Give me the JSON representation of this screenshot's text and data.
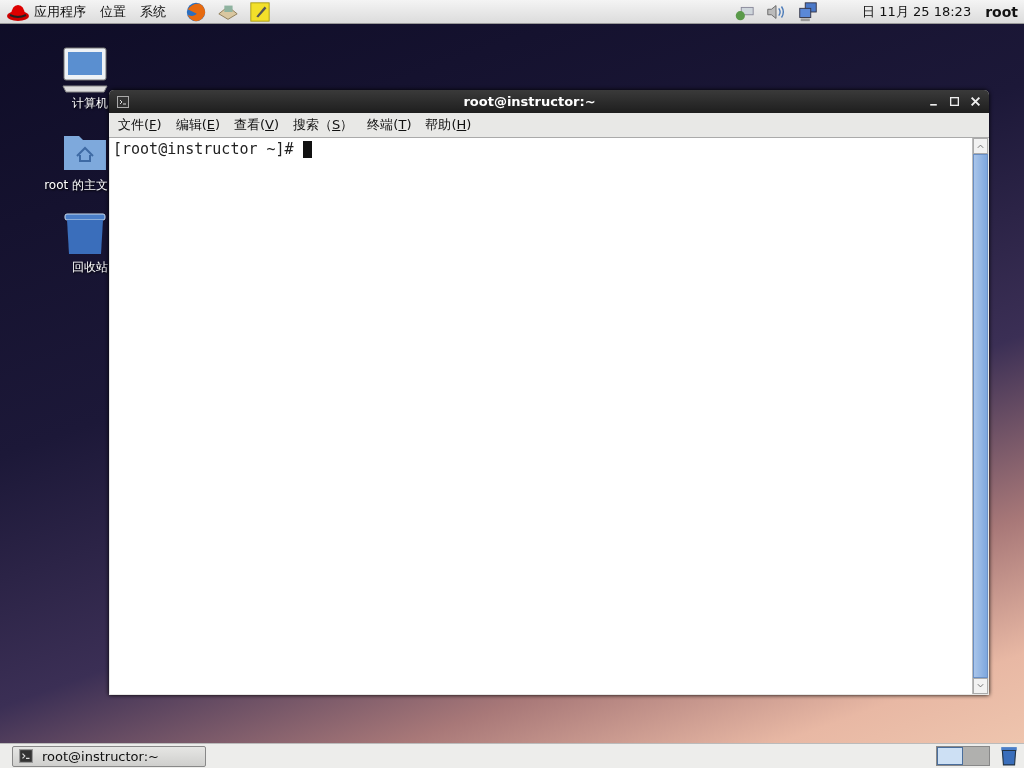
{
  "top_panel": {
    "menus": [
      "应用程序",
      "位置",
      "系统"
    ],
    "clock": "日 11月 25 18:23",
    "user": "root"
  },
  "desktop_icons": [
    {
      "kind": "computer",
      "label": "计算机"
    },
    {
      "kind": "home",
      "label": "root 的主文"
    },
    {
      "kind": "trash",
      "label": "回收站"
    }
  ],
  "window": {
    "title": "root@instructor:~",
    "menu": [
      {
        "prefix": "文件(",
        "key": "F",
        "suffix": ")"
      },
      {
        "prefix": "编辑(",
        "key": "E",
        "suffix": ")"
      },
      {
        "prefix": "查看(",
        "key": "V",
        "suffix": ")"
      },
      {
        "prefix": "搜索（",
        "key": "S",
        "suffix": "）"
      },
      {
        "prefix": "终端(",
        "key": "T",
        "suffix": ")"
      },
      {
        "prefix": "帮助(",
        "key": "H",
        "suffix": ")"
      }
    ],
    "prompt": "[root@instructor ~]#"
  },
  "taskbar": {
    "tasks": [
      {
        "label": "root@instructor:~",
        "selected": false
      }
    ],
    "workspaces": [
      {
        "selected": true
      },
      {
        "selected": false
      }
    ]
  }
}
